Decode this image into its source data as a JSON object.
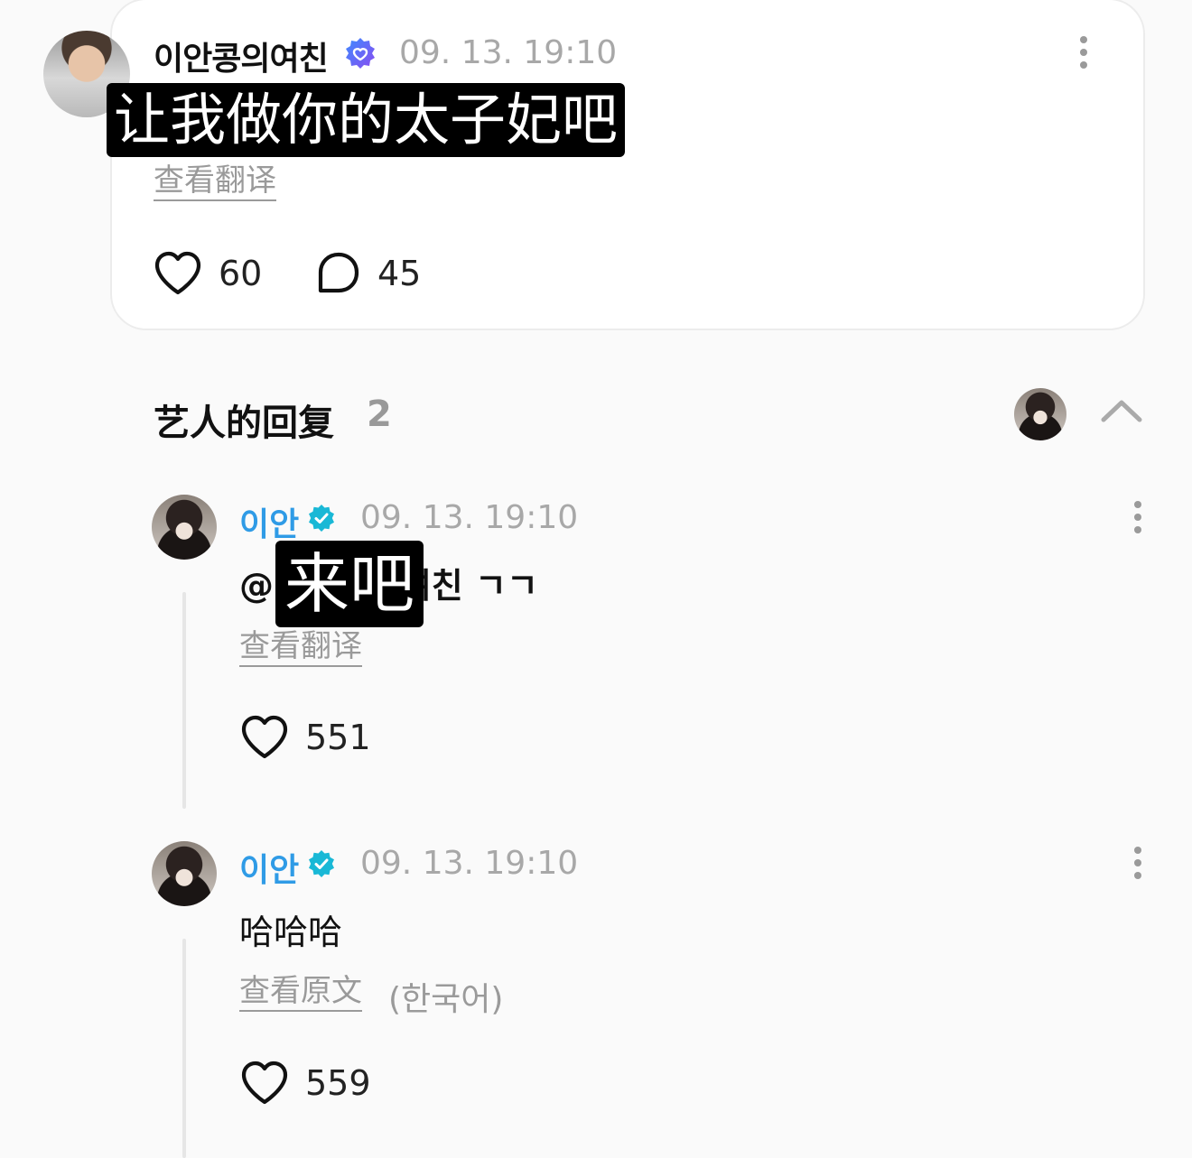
{
  "post": {
    "author": "이안콩의여친",
    "timestamp": "09. 13. 19:10",
    "caption": "让我做你的太子妃吧",
    "translate_link": "查看翻译",
    "likes": "60",
    "comments": "45",
    "verified_icon": "fan-verified-badge-icon"
  },
  "replies_section": {
    "title": "艺人的回复",
    "count": "2"
  },
  "replies": [
    {
      "author": "이안",
      "timestamp": "09. 13. 19:10",
      "text": "@이안콩의여친 ㄱㄱ",
      "caption": "来吧",
      "translate_link": "查看翻译",
      "likes": "551"
    },
    {
      "author": "이안",
      "timestamp": "09. 13. 19:10",
      "text": "哈哈哈",
      "translate_link": "查看原文",
      "language_note": "(한국어)",
      "likes": "559"
    }
  ],
  "colors": {
    "artist_name": "#2f9be6",
    "artist_badge": "#19b8d6",
    "fan_badge": "#7a5cf0",
    "muted_text": "#a8a8a8"
  }
}
